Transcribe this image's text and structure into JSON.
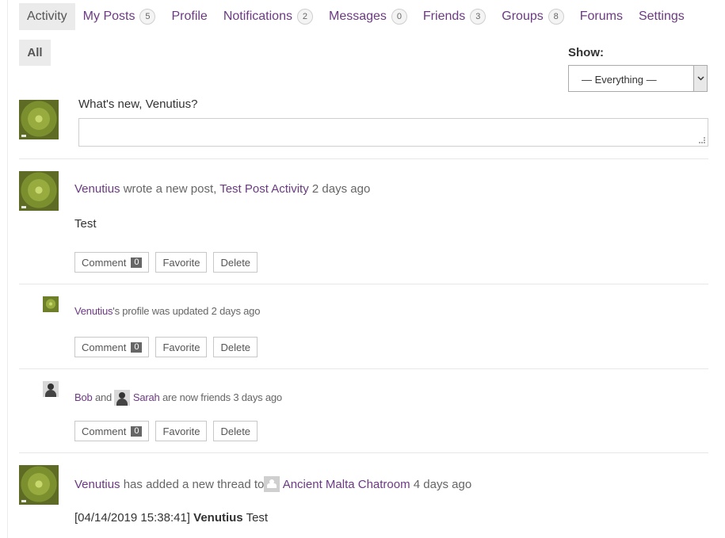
{
  "nav": {
    "items": [
      {
        "label": "Activity",
        "count": null
      },
      {
        "label": "My Posts",
        "count": "5"
      },
      {
        "label": "Profile",
        "count": null
      },
      {
        "label": "Notifications",
        "count": "2"
      },
      {
        "label": "Messages",
        "count": "0"
      },
      {
        "label": "Friends",
        "count": "3"
      },
      {
        "label": "Groups",
        "count": "8"
      },
      {
        "label": "Forums",
        "count": null
      },
      {
        "label": "Settings",
        "count": null
      }
    ]
  },
  "subnav": {
    "all_label": "All"
  },
  "filter": {
    "label": "Show:",
    "selected": "— Everything —"
  },
  "post_form": {
    "prompt": "What's new, Venutius?",
    "value": ""
  },
  "activities": [
    {
      "user": "Venutius",
      "action": "wrote a new post,",
      "target": "Test Post Activity",
      "time": "2 days ago",
      "content": "Test",
      "comment_label": "Comment",
      "comment_count": "0",
      "favorite_label": "Favorite",
      "delete_label": "Delete"
    },
    {
      "user": "Venutius",
      "action": "'s profile was updated",
      "time": "2 days ago",
      "comment_label": "Comment",
      "comment_count": "0",
      "favorite_label": "Favorite",
      "delete_label": "Delete"
    },
    {
      "user": "Bob",
      "joiner": "and",
      "user2": "Sarah",
      "action": "are now friends",
      "time": "3 days ago",
      "comment_label": "Comment",
      "comment_count": "0",
      "favorite_label": "Favorite",
      "delete_label": "Delete"
    },
    {
      "user": "Venutius",
      "action": "has added a new thread to",
      "target": "Ancient Malta Chatroom",
      "time": "4 days ago",
      "content_timestamp": "[04/14/2019 15:38:41]",
      "content_author": "Venutius",
      "content_text": "Test"
    }
  ]
}
